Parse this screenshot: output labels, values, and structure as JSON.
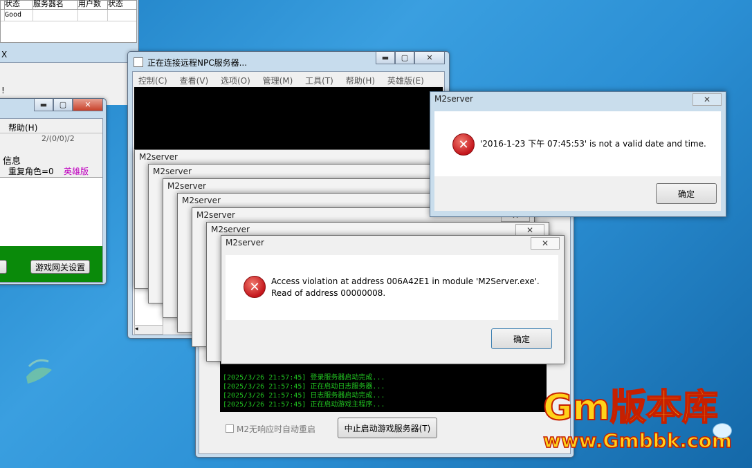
{
  "top_window": {
    "headers": [
      "状态",
      "服务器名",
      "用户数",
      "状态"
    ],
    "row": [
      "Good",
      "",
      "",
      ""
    ]
  },
  "left_window": {
    "menu_help": "帮助(H)",
    "count": "2/(0/0)/2",
    "info_label": "信息",
    "duplicate_role": "重复角色=0",
    "hero_label": "英雄版",
    "gateway_button": "游戏网关设置",
    "fragment_text": "!",
    "fragment_tab": "X"
  },
  "npc_window": {
    "title": "正在连接远程NPC服务器...",
    "menu": [
      "控制(C)",
      "查看(V)",
      "选项(O)",
      "管理(M)",
      "工具(T)",
      "帮助(H)",
      "英雄版(E)"
    ]
  },
  "date_error": {
    "title": "M2server",
    "message": "'2016-1-23 下午 07:45:53' is not a valid date and time.",
    "ok": "确定"
  },
  "stack_title": "M2server",
  "access_error": {
    "title": "M2server",
    "line1": "Access violation at address 006A42E1 in module 'M2Server.exe'.",
    "line2": "Read of address 00000008.",
    "ok": "确定"
  },
  "log_lines": [
    "[2025/3/26 21:57:45] 登录服务器启动完成...",
    "[2025/3/26 21:57:45] 正在启动日志服务器...",
    "[2025/3/26 21:57:45] 日志服务器启动完成...",
    "[2025/3/26 21:57:45] 正在启动游戏主程序..."
  ],
  "m2_controls": {
    "auto_restart": "M2无响应时自动重启",
    "stop_button": "中止启动游戏服务器(T)"
  },
  "watermark": {
    "line1": "Gm版本库",
    "line2": "www.Gmbbk.com"
  },
  "colors": {
    "log_text": "#21c421",
    "hero": "#c000c0",
    "watermark_fill": "#ffd21a",
    "watermark_stroke": "#c62000"
  }
}
